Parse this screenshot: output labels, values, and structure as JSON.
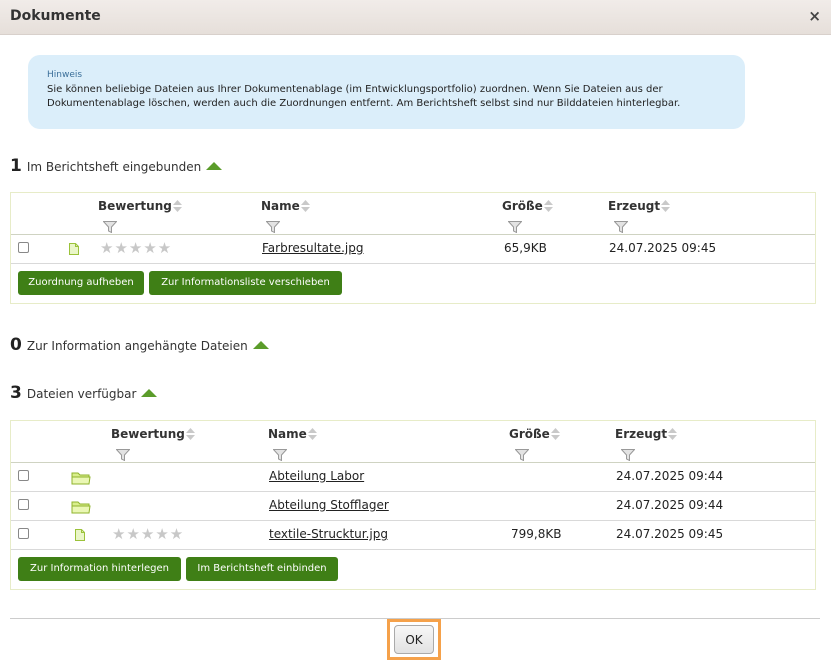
{
  "dialog": {
    "title": "Dokumente",
    "close_symbol": "×"
  },
  "hint": {
    "title": "Hinweis",
    "body": "Sie können beliebige Dateien aus Ihrer Dokumentenablage (im Entwicklungsportfolio) zuordnen. Wenn Sie Dateien aus der Dokumentenablage löschen, werden auch die Zuordnungen entfernt. Am Berichtsheft selbst sind nur Bilddateien hinterlegbar."
  },
  "columns": {
    "rating": "Bewertung",
    "name": "Name",
    "size": "Größe",
    "created": "Erzeugt"
  },
  "section1": {
    "count": "1",
    "label": "Im Berichtsheft eingebunden",
    "rows": [
      {
        "name": "Farbresultate.jpg",
        "size": "65,9KB",
        "created": "24.07.2025 09:45",
        "icon": "file-icon",
        "stars": "★★★★★"
      }
    ],
    "buttons": {
      "unassign": "Zuordnung aufheben",
      "move": "Zur Informationsliste verschieben"
    }
  },
  "section2": {
    "count": "0",
    "label": "Zur Information angehängte Dateien"
  },
  "section3": {
    "count": "3",
    "label": "Dateien verfügbar",
    "rows": [
      {
        "name": "Abteilung Labor",
        "size": "",
        "created": "24.07.2025 09:44",
        "icon": "folder-icon"
      },
      {
        "name": "Abteilung Stofflager",
        "size": "",
        "created": "24.07.2025 09:44",
        "icon": "folder-icon"
      },
      {
        "name": "textile-Strucktur.jpg",
        "size": "799,8KB",
        "created": "24.07.2025 09:45",
        "icon": "file-icon",
        "stars": "★★★★★"
      }
    ],
    "buttons": {
      "info": "Zur Information hinterlegen",
      "embed": "Im Berichtsheft einbinden"
    }
  },
  "footer": {
    "ok": "OK"
  },
  "colors": {
    "accent": "#3f7f16",
    "hint_bg": "#dbeefa",
    "highlight": "#f5a14a"
  }
}
